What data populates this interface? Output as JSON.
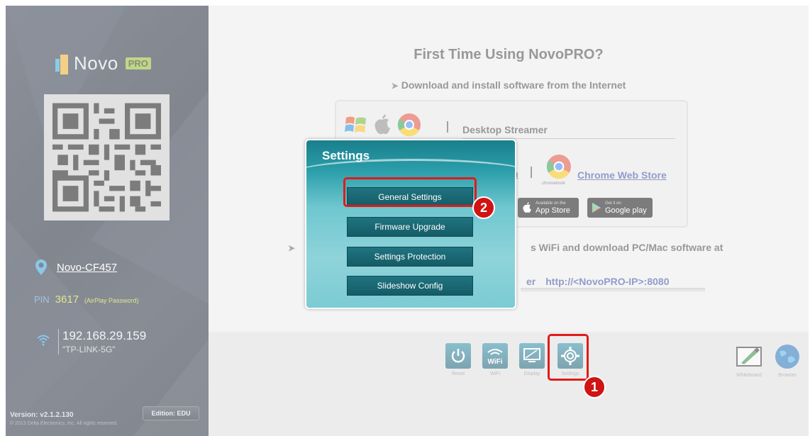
{
  "sidebar": {
    "logo_text": "Novo",
    "logo_badge": "PRO",
    "device_name": "Novo-CF457",
    "pin_label": "PIN",
    "pin_value": "3617",
    "pin_note": "(AirPlay Password)",
    "ip": "192.168.29.159",
    "ssid": "\"TP-LINK-5G\"",
    "version": "Version: v2.1.2.130",
    "copyright": "© 2013 Delta Electronics, Inc. All rights reserved.",
    "edition": "Edition: EDU"
  },
  "main": {
    "title": "First Time Using NovoPRO?",
    "download_line": "Download and install software from the Internet",
    "desktop_streamer": "Desktop Streamer",
    "fragment_m": "m",
    "chromebook_label": "chromebook",
    "chrome_store": "Chrome Web Store",
    "app_store_small": "Available on the",
    "app_store_big": "App Store",
    "google_play_small": "Get it on",
    "google_play_big": "Google play",
    "wifi_line": "s WiFi and download PC/Mac software at",
    "url_prefix": "er",
    "url": "http://<NovoPRO-IP>:8080"
  },
  "toolbar": {
    "reset": "Reset",
    "wifi": "WiFi",
    "wifi_icon_text": "WiFi",
    "display": "Display",
    "settings": "Settings",
    "whiteboard": "Whiteboard",
    "browser": "Browser"
  },
  "dialog": {
    "title": "Settings",
    "items": [
      "General Settings",
      "Firmware Upgrade",
      "Settings Protection",
      "Slideshow Config"
    ]
  },
  "annotations": {
    "step1": "1",
    "step2": "2",
    "color": "#e01b1b"
  },
  "colors": {
    "dialog_accent": "#1f7480",
    "sidebar_bg": "#1c2433",
    "pin_color": "#c8d536"
  }
}
